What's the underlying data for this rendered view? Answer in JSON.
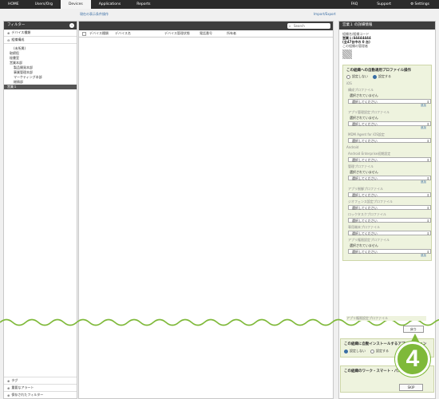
{
  "topnav": {
    "tabs": [
      "HOME",
      "Users/Org",
      "Devices",
      "Applications",
      "Reports"
    ],
    "right": [
      "FAQ",
      "Support",
      "⚙ Settings"
    ]
  },
  "sublinks": {
    "left": "現在の表示条件操作",
    "right": "Import/Export"
  },
  "sidebar": {
    "header": "フィルター",
    "rows": [
      "デバイス種類",
      "組織構成"
    ],
    "tree": [
      {
        "label": "(未所属)",
        "level": 1
      },
      {
        "label": "取締役",
        "level": 1
      },
      {
        "label": "秘書室",
        "level": 1
      },
      {
        "label": "営業本部",
        "level": 0
      },
      {
        "label": "製品開発本部",
        "level": 1
      },
      {
        "label": "事業管理本部",
        "level": 1
      },
      {
        "label": "マーケティング本部",
        "level": 1
      },
      {
        "label": "総務部",
        "level": 1
      },
      {
        "label": "営業１",
        "level": 0,
        "selected": true
      }
    ],
    "bottom": [
      "タグ",
      "重要なアラート",
      "保存されたフィルター"
    ]
  },
  "center": {
    "search_placeholder": "Search",
    "columns": [
      "デバイス種類",
      "デバイス名",
      "デバイス管理状態",
      "電話番号",
      "所有者"
    ]
  },
  "rpanel": {
    "header": "営業１ の詳細情報",
    "info": [
      "組織名/組織コード",
      "営業１/44444444",
      "(全47台中の 0 台)",
      "この組織の管理者"
    ],
    "box1": {
      "title": "この組織への自動適用プロファイル操作",
      "radio_off": "設定しない",
      "radio_on": "設定する",
      "ios": "iOS",
      "android": "Android",
      "select": "選択してください",
      "not_selected": "選択されていません",
      "add": "追加",
      "ios_profiles": [
        "構成プロファイル",
        "アプリ管理設定プロファイル",
        "MDM Agent for iOS設定"
      ],
      "android_profiles": [
        "Android Enterprise初期設定",
        "管理プロファイル",
        "アプリ制御プロファイル",
        "ジオフェンス設定プロファイル",
        "ロックタスクプロファイル",
        "専用端末プロファイル",
        "アプリ権限設定プロファイル",
        "アプリ権限設定プロファイル"
      ]
    },
    "back": "戻り",
    "box2": {
      "title": "この組織に自動インストールするアプリケーション",
      "off": "設定しない",
      "on": "設定する"
    },
    "box3": {
      "title": "この組織のワーク・スマート・パスワード"
    },
    "skip": "SKIP"
  },
  "badge": "4"
}
